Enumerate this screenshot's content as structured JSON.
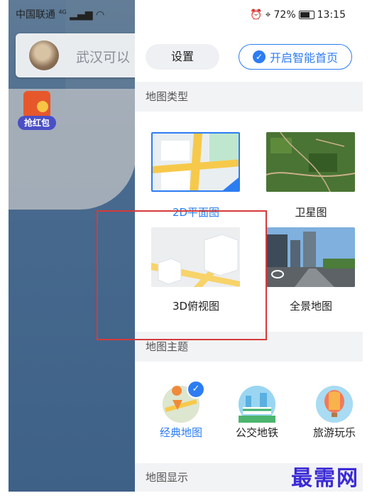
{
  "status": {
    "carrier": "中国联通",
    "network": "4G",
    "battery": "72%",
    "time": "13:15"
  },
  "search": {
    "text": "武汉可以"
  },
  "redpacket": {
    "label": "抢红包"
  },
  "panel": {
    "settings_label": "设置",
    "smart_home_label": "开启智能首页",
    "sections": {
      "map_type": "地图类型",
      "map_theme": "地图主题",
      "map_display": "地图显示"
    },
    "map_types": [
      {
        "label": "2D平面图",
        "selected": true
      },
      {
        "label": "卫星图",
        "selected": false
      },
      {
        "label": "3D俯视图",
        "selected": false
      },
      {
        "label": "全景地图",
        "selected": false
      }
    ],
    "themes": [
      {
        "label": "经典地图",
        "selected": true
      },
      {
        "label": "公交地铁",
        "selected": false
      },
      {
        "label": "旅游玩乐",
        "selected": false
      }
    ]
  },
  "watermark": "最需网",
  "colors": {
    "accent": "#2d7df2",
    "highlight_box": "#d63a3a"
  }
}
